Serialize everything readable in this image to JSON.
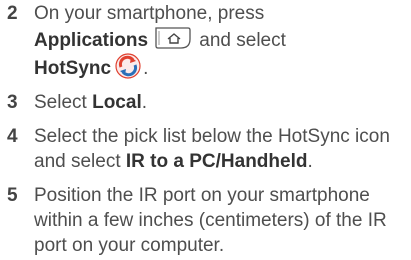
{
  "steps": [
    {
      "number": "2",
      "t1": "On your smartphone, press",
      "b1": "Applications",
      "t2": " and select",
      "b2": "HotSync",
      "t3": ".",
      "icons": [
        "applications-button-icon",
        "hotsync-icon"
      ]
    },
    {
      "number": "3",
      "t1": "Select ",
      "b1": "Local",
      "t2": "."
    },
    {
      "number": "4",
      "t1": "Select the pick list below the HotSync icon and select ",
      "b1": "IR to a PC/Handheld",
      "t2": "."
    },
    {
      "number": "5",
      "t1": "Position the IR port on your smartphone within a few inches (centimeters) of the IR port on your computer."
    }
  ],
  "colors": {
    "hotsync_red": "#e0402f",
    "hotsync_blue": "#2a6fb8",
    "text": "#4e4e4e"
  }
}
